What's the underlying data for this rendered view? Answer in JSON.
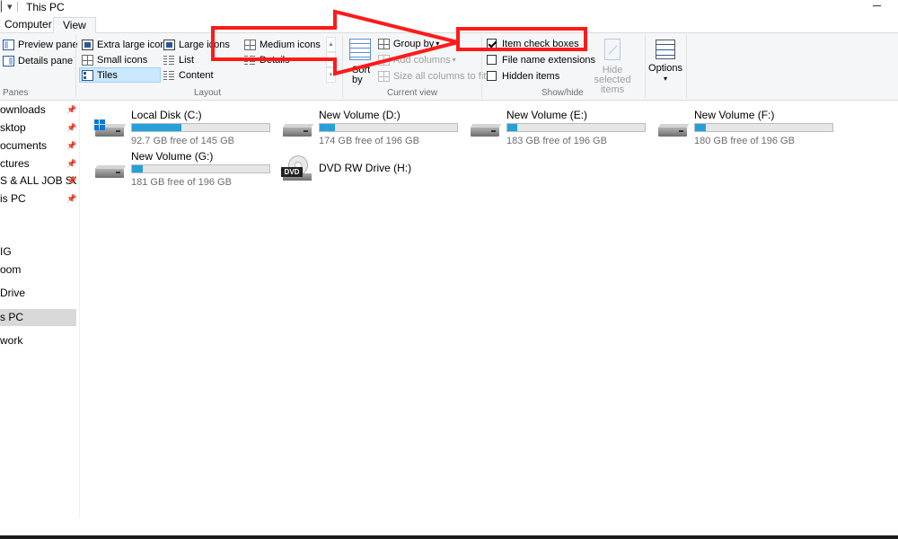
{
  "window": {
    "title": "This PC"
  },
  "tabs": {
    "computer": "Computer",
    "view": "View"
  },
  "ribbon": {
    "panes": {
      "preview_pane": "Preview pane",
      "details_pane": "Details pane",
      "label": "Panes"
    },
    "layout": {
      "extra_large_icons": "Extra large icons",
      "large_icons": "Large icons",
      "medium_icons": "Medium icons",
      "small_icons": "Small icons",
      "list": "List",
      "details": "Details",
      "tiles": "Tiles",
      "content": "Content",
      "label": "Layout",
      "selected": "Tiles"
    },
    "current_view": {
      "sort_by": "Sort",
      "sort_by_2": "by",
      "group_by": "Group by",
      "add_columns": "Add columns",
      "size_all_columns": "Size all columns to fit",
      "label": "Current view"
    },
    "show_hide": {
      "item_check_boxes": "Item check boxes",
      "item_check_boxes_checked": true,
      "file_name_extensions": "File name extensions",
      "file_name_extensions_checked": false,
      "hidden_items": "Hidden items",
      "hidden_items_checked": false,
      "hide_selected_1": "Hide selected",
      "hide_selected_2": "items",
      "label": "Show/hide"
    },
    "options": {
      "label": "Options"
    }
  },
  "nav": {
    "items": [
      {
        "label": "ownloads",
        "pinned": true
      },
      {
        "label": "sktop",
        "pinned": true
      },
      {
        "label": "ocuments",
        "pinned": true
      },
      {
        "label": "ctures",
        "pinned": true
      },
      {
        "label": "S & ALL JOB SOI",
        "pinned": true
      },
      {
        "label": "is PC",
        "pinned": true
      },
      {
        "label": "IG",
        "pinned": false
      },
      {
        "label": "oom",
        "pinned": false
      },
      {
        "label": "Drive",
        "pinned": false
      },
      {
        "label": "s PC",
        "pinned": false,
        "selected": true
      },
      {
        "label": "work",
        "pinned": false
      }
    ],
    "pin_glyph": "📌"
  },
  "drives": [
    {
      "name": "Local Disk (C:)",
      "free": "92.7 GB free of 145 GB",
      "used_fraction": 0.36,
      "type": "system"
    },
    {
      "name": "New Volume (D:)",
      "free": "174 GB free of 196 GB",
      "used_fraction": 0.11,
      "type": "hdd"
    },
    {
      "name": "New Volume (E:)",
      "free": "183 GB free of 196 GB",
      "used_fraction": 0.07,
      "type": "hdd"
    },
    {
      "name": "New Volume (F:)",
      "free": "180 GB free of 196 GB",
      "used_fraction": 0.08,
      "type": "hdd"
    },
    {
      "name": "New Volume (G:)",
      "free": "181 GB free of 196 GB",
      "used_fraction": 0.08,
      "type": "hdd"
    },
    {
      "name": "DVD RW Drive (H:)",
      "free": "",
      "type": "dvd",
      "badge": "DVD"
    }
  ],
  "colors": {
    "annotation": "#ff1a1a",
    "bar_fill": "#26a0da",
    "selection": "#cce8ff"
  }
}
